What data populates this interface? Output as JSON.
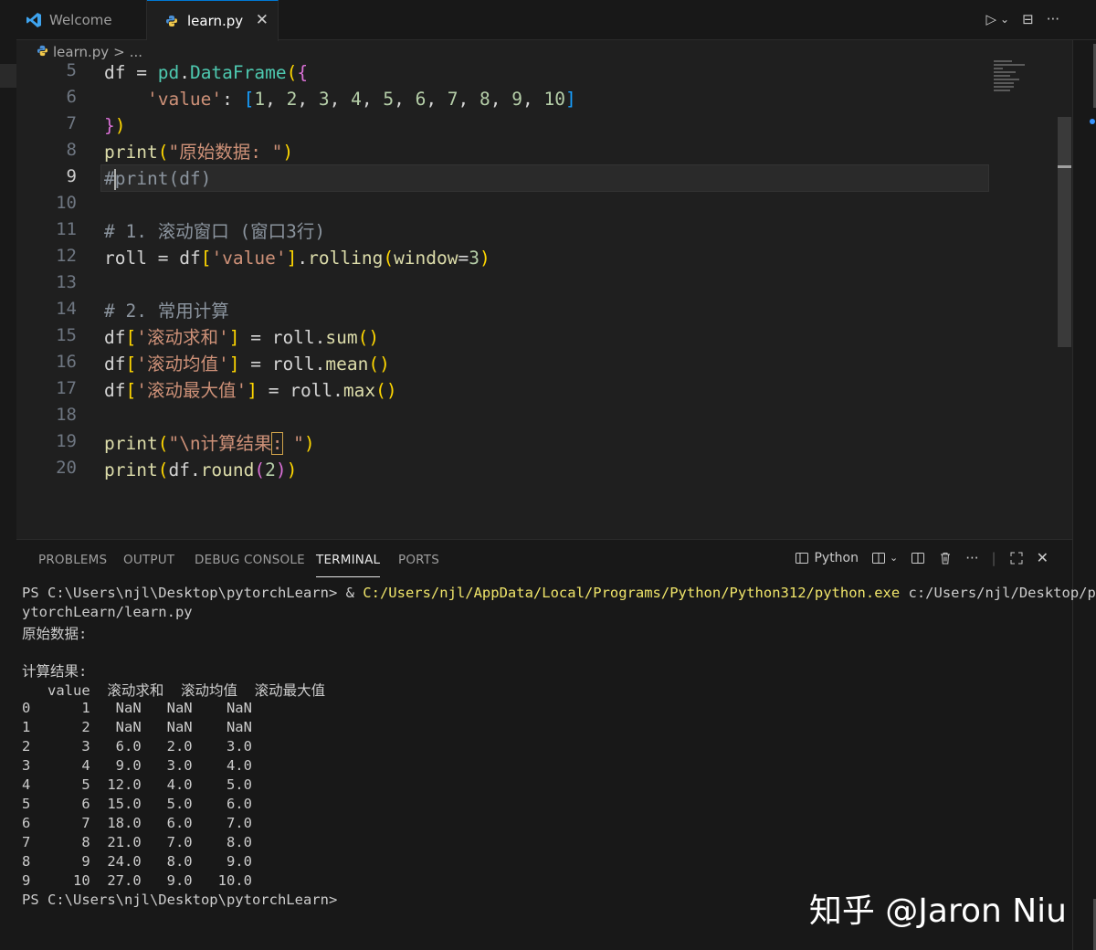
{
  "tabs": [
    {
      "label": "Welcome",
      "icon": "vscode-logo-icon",
      "active": false
    },
    {
      "label": "learn.py",
      "icon": "python-icon",
      "active": true
    }
  ],
  "tab_actions": {
    "run": "▷",
    "run_menu": "⌄",
    "split": "⊟",
    "more": "···"
  },
  "breadcrumb": {
    "file": "learn.py",
    "sep": ">",
    "rest": "..."
  },
  "editor": {
    "line_numbers": [
      "5",
      "6",
      "7",
      "8",
      "9",
      "10",
      "11",
      "12",
      "13",
      "14",
      "15",
      "16",
      "17",
      "18",
      "19",
      "20"
    ],
    "current_line": "9"
  },
  "code": {
    "l5": [
      "df",
      " = ",
      "pd",
      ".",
      "DataFrame",
      "(",
      "{"
    ],
    "l6": [
      "    ",
      "'value'",
      ": ",
      "[",
      "1",
      ", ",
      "2",
      ", ",
      "3",
      ", ",
      "4",
      ", ",
      "5",
      ", ",
      "6",
      ", ",
      "7",
      ", ",
      "8",
      ", ",
      "9",
      ", ",
      "10",
      "]"
    ],
    "l7": [
      "}",
      ")"
    ],
    "l8": [
      "print",
      "(",
      "\"原始数据: \"",
      ")"
    ],
    "l9": [
      "#",
      "print(df)"
    ],
    "l10": [],
    "l11": [
      "# 1. 滚动窗口 (窗口3行)"
    ],
    "l12": [
      "roll",
      " = ",
      "df",
      "[",
      "'value'",
      "]",
      ".",
      "rolling",
      "(",
      "window",
      "=",
      "3",
      ")"
    ],
    "l13": [],
    "l14": [
      "# 2. 常用计算"
    ],
    "l15": [
      "df",
      "[",
      "'滚动求和'",
      "]",
      " = ",
      "roll",
      ".",
      "sum",
      "(",
      ")"
    ],
    "l16": [
      "df",
      "[",
      "'滚动均值'",
      "]",
      " = ",
      "roll",
      ".",
      "mean",
      "(",
      ")"
    ],
    "l17": [
      "df",
      "[",
      "'滚动最大值'",
      "]",
      " = ",
      "roll",
      ".",
      "max",
      "(",
      ")"
    ],
    "l18": [],
    "l19": [
      "print",
      "(",
      "\"\\n计算结果",
      ":",
      " \"",
      ")"
    ],
    "l20": [
      "print",
      "(",
      "df",
      ".",
      "round",
      "(",
      "2",
      ")",
      ")"
    ]
  },
  "panel": {
    "tabs": [
      "PROBLEMS",
      "OUTPUT",
      "DEBUG CONSOLE",
      "TERMINAL",
      "PORTS"
    ],
    "active_tab": "TERMINAL",
    "shell_label": "Python"
  },
  "terminal": {
    "cmd_prompt": "PS C:\\Users\\njl\\Desktop\\pytorchLearn> & ",
    "cmd_exe": "C:/Users/njl/AppData/Local/Programs/Python/Python312/python.exe",
    "cmd_arg": " c:/Users/njl/Desktop/p",
    "cmd_wrap": "ytorchLearn/learn.py",
    "out1": "原始数据:",
    "out2": "",
    "out3": "计算结果:",
    "table_header": "   value  滚动求和  滚动均值  滚动最大值",
    "table_rows": [
      "0      1   NaN   NaN    NaN",
      "1      2   NaN   NaN    NaN",
      "2      3   6.0   2.0    3.0",
      "3      4   9.0   3.0    4.0",
      "4      5  12.0   4.0    5.0",
      "5      6  15.0   5.0    6.0",
      "6      7  18.0   6.0    7.0",
      "7      8  21.0   7.0    8.0",
      "8      9  24.0   8.0    9.0",
      "9     10  27.0   9.0   10.0"
    ],
    "final_prompt": "PS C:\\Users\\njl\\Desktop\\pytorchLearn>"
  },
  "watermark": "知乎 @Jaron Niu",
  "colors": {
    "accent": "#0078d4",
    "editor_bg": "#1f1f1f",
    "panel_bg": "#181818"
  }
}
